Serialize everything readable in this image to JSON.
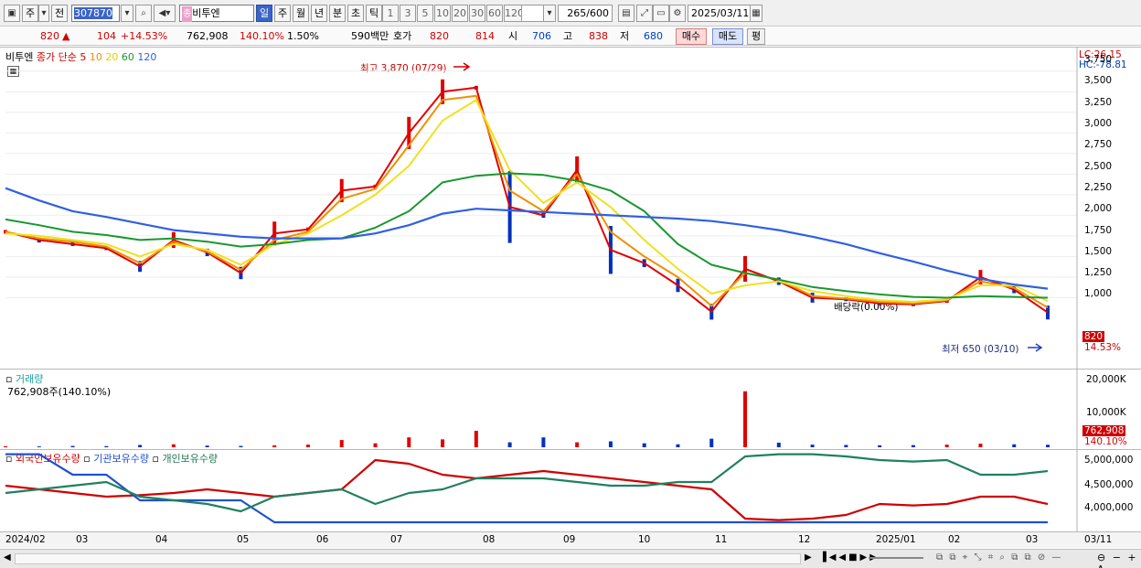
{
  "toolbar": {
    "market_label": "주",
    "prev_label": "전",
    "code_value": "307870",
    "name_value": "비투엔",
    "name_badge": "종",
    "periods": [
      "일",
      "주",
      "월",
      "년",
      "분",
      "초",
      "틱"
    ],
    "active_period": "일",
    "intervals": [
      "1",
      "3",
      "5",
      "10",
      "20",
      "30",
      "60",
      "120"
    ],
    "count_value": "265",
    "count_total": "/600",
    "date_value": "2025/03/11"
  },
  "quote": {
    "price": "820",
    "change": "104",
    "change_pct": "+14.53%",
    "volume": "762,908",
    "volume_ratio": "140.10%",
    "turnover": "1.50%",
    "amount": "590백만",
    "ask_label": "호가",
    "ask": "820",
    "bid": "814",
    "open_label": "시",
    "open": "706",
    "high_label": "고",
    "high": "838",
    "low_label": "저",
    "low": "680",
    "buy_label": "매수",
    "sell_label": "매도",
    "flat_label": "평"
  },
  "price_pane": {
    "stock_name": "비투엔",
    "legend_prefix": "종가 단순",
    "ma_periods": [
      "5",
      "10",
      "20",
      "60",
      "120"
    ],
    "lc_label": "LC:26.15",
    "hc_label": "HC:-78.81",
    "high_note": "최고 3,870 (07/29)",
    "low_note": "최저 650 (03/10)",
    "dividend_note": "배당락(0.00%)",
    "y_ticks": [
      "3,750",
      "3,500",
      "3,250",
      "3,000",
      "2,750",
      "2,500",
      "2,250",
      "2,000",
      "1,750",
      "1,500",
      "1,250",
      "1,000"
    ],
    "current_price_tag": "820",
    "current_change_tag": "14.53%"
  },
  "volume_pane": {
    "title": "거래량",
    "subtitle": "762,908주(140.10%)",
    "y_ticks": [
      "20,000K",
      "10,000K"
    ],
    "current_tag": "762,908",
    "ratio_tag": "140.10%"
  },
  "holding_pane": {
    "legend": [
      "외국인보유수량",
      "기관보유수량",
      "개인보유수량"
    ],
    "y_ticks": [
      "5,000,000",
      "4,500,000",
      "4,000,000"
    ]
  },
  "date_axis": {
    "labels": [
      "2024/02",
      "03",
      "04",
      "05",
      "06",
      "07",
      "08",
      "09",
      "10",
      "11",
      "12",
      "2025/01",
      "02",
      "03"
    ],
    "right_label": "03/11"
  },
  "colors": {
    "ma5": "#e00000",
    "ma10": "#f09000",
    "ma20": "#f0e020",
    "ma60": "#189830",
    "ma120": "#3060e0",
    "up": "#e00000",
    "down": "#0030c0"
  },
  "chart_data": [
    {
      "type": "line",
      "title": "",
      "series": [
        {
          "name": "5",
          "values": [
            1800,
            1700,
            1650,
            1600,
            1380,
            1700,
            1550,
            1300,
            1780,
            1830,
            2300,
            2350,
            3000,
            3500,
            3550,
            2100,
            2000,
            2550,
            1580,
            1420,
            1150,
            830,
            1350,
            1200,
            1000,
            980,
            930,
            920,
            960,
            1250,
            1100,
            820
          ]
        },
        {
          "name": "10",
          "values": [
            1800,
            1720,
            1680,
            1620,
            1420,
            1680,
            1560,
            1340,
            1700,
            1800,
            2200,
            2320,
            2850,
            3400,
            3450,
            2300,
            2050,
            2500,
            1800,
            1500,
            1250,
            900,
            1300,
            1220,
            1020,
            990,
            950,
            930,
            970,
            1200,
            1120,
            880
          ]
        },
        {
          "name": "20",
          "values": [
            1780,
            1750,
            1700,
            1650,
            1500,
            1650,
            1580,
            1400,
            1650,
            1780,
            2000,
            2250,
            2600,
            3150,
            3400,
            2550,
            2150,
            2400,
            2100,
            1700,
            1350,
            1050,
            1150,
            1200,
            1080,
            1020,
            970,
            950,
            980,
            1150,
            1150,
            960
          ]
        },
        {
          "name": "60",
          "values": [
            1950,
            1880,
            1800,
            1760,
            1700,
            1720,
            1680,
            1620,
            1650,
            1700,
            1720,
            1850,
            2050,
            2400,
            2480,
            2510,
            2490,
            2420,
            2300,
            2050,
            1650,
            1400,
            1300,
            1220,
            1130,
            1080,
            1040,
            1010,
            1000,
            1020,
            1010,
            1000
          ]
        },
        {
          "name": "120",
          "values": [
            2330,
            2180,
            2050,
            1980,
            1900,
            1820,
            1780,
            1740,
            1720,
            1720,
            1720,
            1780,
            1880,
            2020,
            2080,
            2060,
            2040,
            2020,
            2000,
            1980,
            1960,
            1930,
            1880,
            1820,
            1740,
            1650,
            1540,
            1440,
            1330,
            1230,
            1160,
            1110
          ]
        }
      ],
      "ylim": [
        650,
        3870
      ]
    },
    {
      "type": "bar",
      "title": "거래량",
      "values": [
        300,
        250,
        400,
        350,
        700,
        900,
        500,
        400,
        600,
        800,
        2200,
        1200,
        3000,
        2400,
        5000,
        1500,
        3000,
        1500,
        1800,
        1200,
        900,
        2600,
        17000,
        1400,
        800,
        700,
        600,
        650,
        800,
        1100,
        900,
        763
      ]
    }
  ]
}
